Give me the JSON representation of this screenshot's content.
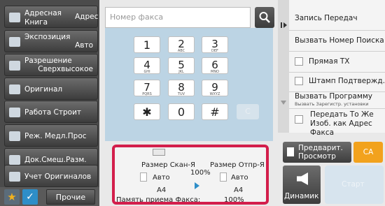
{
  "left_buttons": [
    {
      "label_line1": "Адресная",
      "label_line2": "Книга"
    },
    {
      "label": "Экспозиция",
      "value": "Авто"
    },
    {
      "label": "Разрешение",
      "value": "Сверхвысокое"
    },
    {
      "label": "Оригинал"
    },
    {
      "label": "Работа Строит"
    },
    {
      "label": "Реж. Медл.Прос"
    },
    {
      "label": "Док.Смеш.Разм."
    },
    {
      "label": "Учет Оригиналов"
    }
  ],
  "bottom_left": {
    "other_label": "Прочие"
  },
  "address_label": "Адрес",
  "fax_input": {
    "placeholder": "Номер факса"
  },
  "keypad": [
    {
      "n": "1",
      "s": ""
    },
    {
      "n": "2",
      "s": "ABC"
    },
    {
      "n": "3",
      "s": "DEF"
    },
    {
      "n": "4",
      "s": "GHI"
    },
    {
      "n": "5",
      "s": "JKL"
    },
    {
      "n": "6",
      "s": "MNO"
    },
    {
      "n": "7",
      "s": "PQRS"
    },
    {
      "n": "8",
      "s": "TUV"
    },
    {
      "n": "9",
      "s": "WXYZ"
    },
    {
      "n": "✱",
      "s": ""
    },
    {
      "n": "0",
      "s": ""
    },
    {
      "n": "#",
      "s": ""
    }
  ],
  "clear_label": "C",
  "status": {
    "scan_size_label": "Размер Скан-Я",
    "send_size_label": "Размер Отпр-Я",
    "ratio": "100%",
    "scan_mode": "Авто",
    "scan_paper": "A4",
    "send_mode": "Авто",
    "send_paper": "A4",
    "memory_label": "Память приема Факса:",
    "memory_value": "100%"
  },
  "right_panel": {
    "record": "Запись Передач",
    "recall_search": "Вызвать Номер Поиска",
    "direct_tx": "Прямая ТХ",
    "stamp": "Штамп Подтвержд.",
    "call_program": "Вызвать Программу",
    "call_program_sub": "Вызвать Зарегистр. установки",
    "same_image": "Передать То Же Изоб. как Адрес Факса"
  },
  "preview_label": "Предварит. Просмотр",
  "ca_label": "CA",
  "speaker_label": "Динамик",
  "start_label": "Старт",
  "colors": {
    "highlight": "#d31e4b",
    "ca": "#f2a21d",
    "keypad_bg": "#bcd4e4"
  }
}
